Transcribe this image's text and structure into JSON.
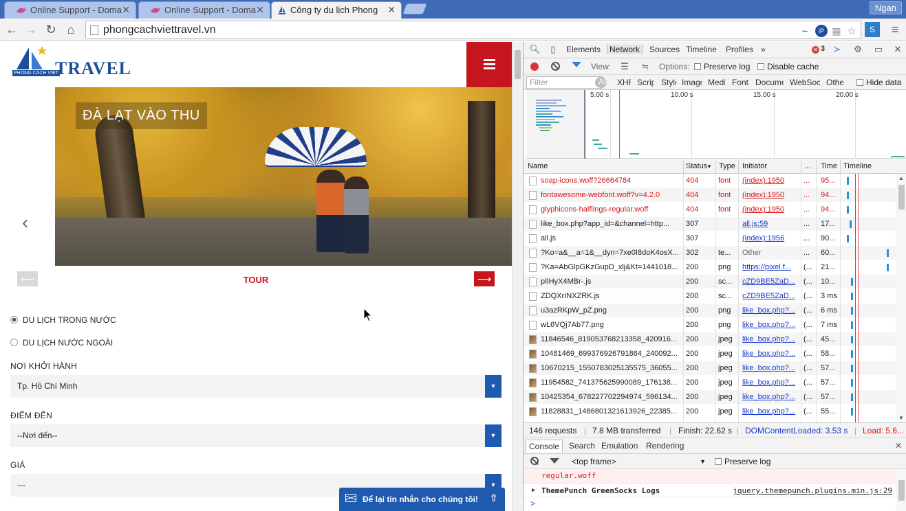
{
  "browser": {
    "tabs": [
      {
        "title": "Online Support - Doma",
        "active": false
      },
      {
        "title": "Online Support - Doma",
        "active": false
      },
      {
        "title": "Công ty du lịch Phong",
        "active": true
      }
    ],
    "user": "Ngan",
    "url": "phongcachviettravel.vn"
  },
  "site": {
    "logo_text": "TRAVEL",
    "logo_sub": "PHONG CÁCH VIỆT",
    "hero_caption": "ĐÀ LẠT VÀO THU",
    "tour_title": "TOUR",
    "radios": [
      {
        "label": "DU LỊCH TRONG NƯỚC",
        "checked": true
      },
      {
        "label": "DU LỊCH NƯỚC NGOÀI",
        "checked": false
      }
    ],
    "fields": [
      {
        "label": "NƠI KHỞI HÀNH",
        "value": "Tp. Hồ Chí Minh"
      },
      {
        "label": "ĐIỂM ĐẾN",
        "value": "--Nơi đến--"
      },
      {
        "label": "GIÁ",
        "value": "---"
      }
    ],
    "chat_label": "Để lại tin nhắn cho chúng tôi!",
    "brand_red": "#c4161c",
    "brand_blue": "#1d5ab0"
  },
  "devtools": {
    "tabs": [
      "Elements",
      "Network",
      "Sources",
      "Timeline",
      "Profiles"
    ],
    "active_tab": "Network",
    "more": "»",
    "error_count": "3",
    "view_label": "View:",
    "options_label": "Options:",
    "preserve_log": "Preserve log",
    "disable_cache": "Disable cache",
    "filter_placeholder": "Filter",
    "types": [
      "All",
      "XHR",
      "Scripts",
      "Styles",
      "Images",
      "Media",
      "Fonts",
      "Documents",
      "WebSockets",
      "Other"
    ],
    "hide_data": "Hide data",
    "overview_ticks": [
      "5.00 s",
      "10.00 s",
      "15.00 s",
      "20.00 s"
    ],
    "columns": [
      "Name",
      "Status",
      "Type",
      "Initiator",
      "...",
      "Time",
      "Timeline"
    ],
    "requests": [
      {
        "name": "soap-icons.woff?26664784",
        "status": "404",
        "type": "font",
        "initiator": "(index):1950",
        "size": "...",
        "time": "95...",
        "error": true,
        "bar": 0.08
      },
      {
        "name": "fontawesome-webfont.woff?v=4.2.0",
        "status": "404",
        "type": "font",
        "initiator": "(index):1950",
        "size": "...",
        "time": "94...",
        "error": true,
        "bar": 0.08
      },
      {
        "name": "glyphicons-halflings-regular.woff",
        "status": "404",
        "type": "font",
        "initiator": "(index):1950",
        "size": "...",
        "time": "94...",
        "error": true,
        "bar": 0.08
      },
      {
        "name": "like_box.php?app_id=&channel=http...",
        "status": "307",
        "type": "",
        "initiator": "all.js:59",
        "size": "...",
        "time": "17...",
        "error": false,
        "bar": 0.14
      },
      {
        "name": "all.js",
        "status": "307",
        "type": "",
        "initiator": "(index):1956",
        "size": "...",
        "time": "90...",
        "error": false,
        "bar": 0.08
      },
      {
        "name": "?Ko=a&__a=1&__dyn=7xe0I8doK4osX...",
        "status": "302",
        "type": "te...",
        "initiator": "Other",
        "size": "...",
        "time": "60...",
        "error": false,
        "bar": 0.95
      },
      {
        "name": "?Ka=AbGlpGKzGupD_xlj&Kt=1441018...",
        "status": "200",
        "type": "png",
        "initiator": "https://pixel.f...",
        "size": "(...",
        "time": "21...",
        "error": false,
        "bar": 0.95
      },
      {
        "name": "pIlHyX4MBr-.js",
        "status": "200",
        "type": "sc...",
        "initiator": "cZD9BE5ZaD...",
        "size": "(...",
        "time": "10...",
        "error": false,
        "bar": 0.16
      },
      {
        "name": "ZDQXrINXZRK.js",
        "status": "200",
        "type": "sc...",
        "initiator": "cZD9BE5ZaD...",
        "size": "(...",
        "time": "3 ms",
        "error": false,
        "bar": 0.16
      },
      {
        "name": "u3azRKpW_pZ.png",
        "status": "200",
        "type": "png",
        "initiator": "like_box.php?...",
        "size": "(...",
        "time": "6 ms",
        "error": false,
        "bar": 0.16
      },
      {
        "name": "wL6VQj7Ab77.png",
        "status": "200",
        "type": "png",
        "initiator": "like_box.php?...",
        "size": "(...",
        "time": "7 ms",
        "error": false,
        "bar": 0.16
      },
      {
        "name": "11846546_819053768213358_420916...",
        "status": "200",
        "type": "jpeg",
        "initiator": "like_box.php?...",
        "size": "(...",
        "time": "45...",
        "error": false,
        "bar": 0.16
      },
      {
        "name": "10481469_699376926791864_240092...",
        "status": "200",
        "type": "jpeg",
        "initiator": "like_box.php?...",
        "size": "(...",
        "time": "58...",
        "error": false,
        "bar": 0.16
      },
      {
        "name": "10670215_1550783025135575_36055...",
        "status": "200",
        "type": "jpeg",
        "initiator": "like_box.php?...",
        "size": "(...",
        "time": "57...",
        "error": false,
        "bar": 0.16
      },
      {
        "name": "11954582_741375625990089_176138...",
        "status": "200",
        "type": "jpeg",
        "initiator": "like_box.php?...",
        "size": "(...",
        "time": "57...",
        "error": false,
        "bar": 0.16
      },
      {
        "name": "10425354_678227702294974_596134...",
        "status": "200",
        "type": "jpeg",
        "initiator": "like_box.php?...",
        "size": "(...",
        "time": "57...",
        "error": false,
        "bar": 0.16
      },
      {
        "name": "11828831_1486801321613926_22385...",
        "status": "200",
        "type": "jpeg",
        "initiator": "like_box.php?...",
        "size": "(...",
        "time": "55...",
        "error": false,
        "bar": 0.16
      }
    ],
    "summary": {
      "requests": "146 requests",
      "transferred": "7.8 MB transferred",
      "finish": "Finish: 22.62 s",
      "dom": "DOMContentLoaded: 3.53 s",
      "load": "Load: 5.6..."
    },
    "drawer_tabs": [
      "Console",
      "Search",
      "Emulation",
      "Rendering"
    ],
    "frame": "<top frame>",
    "console_error": "regular.woff",
    "console_log": "ThemePunch GreenSocks Logs",
    "console_log_src": "jquery.themepunch.plugins.min.js:29",
    "prompt": ">",
    "colors": {
      "error": "#d6171a",
      "dom_line": "#1c39c9",
      "load_line": "#e03030"
    }
  }
}
